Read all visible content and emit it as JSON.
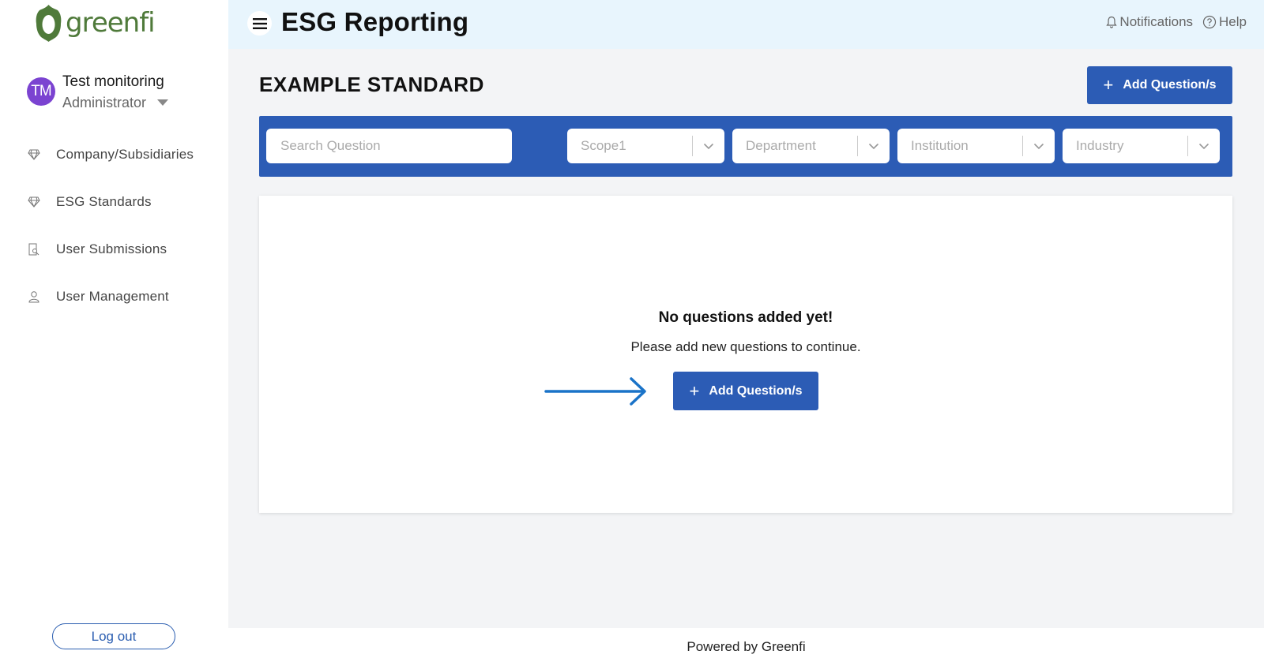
{
  "brand": {
    "name": "greenfi",
    "color": "#4f7a3a",
    "icon": "greenfi-leaf-logo"
  },
  "profile": {
    "initials": "TM",
    "name": "Test monitoring",
    "role": "Administrator",
    "avatar_color": "#7b43d1"
  },
  "sidebar": {
    "items": [
      {
        "label": "Company/Subsidiaries",
        "icon": "diamond-icon"
      },
      {
        "label": "ESG Standards",
        "icon": "diamond-icon"
      },
      {
        "label": "User Submissions",
        "icon": "document-search-icon"
      },
      {
        "label": "User Management",
        "icon": "user-icon"
      }
    ],
    "logout_label": "Log out"
  },
  "header": {
    "title": "ESG Reporting",
    "notifications_label": "Notifications",
    "help_label": "Help"
  },
  "main": {
    "page_title": "EXAMPLE STANDARD",
    "add_button_label": "Add Question/s",
    "search": {
      "placeholder": "Search Question"
    },
    "filters": [
      {
        "placeholder": "Scope1"
      },
      {
        "placeholder": "Department"
      },
      {
        "placeholder": "Institution"
      },
      {
        "placeholder": "Industry"
      }
    ],
    "empty_state": {
      "title": "No questions added yet!",
      "subtitle": "Please add new questions to continue.",
      "button_label": "Add Question/s"
    }
  },
  "footer": {
    "text": "Powered by Greenfi"
  },
  "colors": {
    "primary": "#2c5cb5",
    "topbar": "#e8f5fd",
    "arrow": "#1a73c8"
  }
}
